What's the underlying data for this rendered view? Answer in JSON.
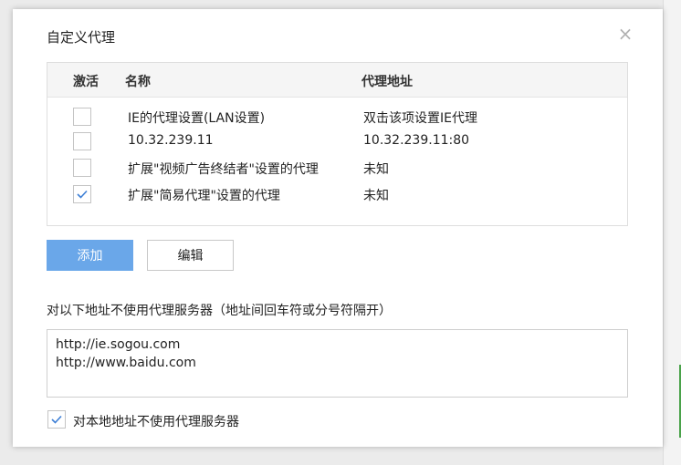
{
  "dialog": {
    "title": "自定义代理",
    "close_icon": "close-icon"
  },
  "table": {
    "headers": {
      "active": "激活",
      "name": "名称",
      "address": "代理地址"
    },
    "rows": [
      {
        "checked": false,
        "name": "IE的代理设置(LAN设置)",
        "address": "双击该项设置IE代理"
      },
      {
        "checked": false,
        "name": "10.32.239.11",
        "address": "10.32.239.11:80"
      },
      {
        "checked": false,
        "name": "扩展\"视频广告终结者\"设置的代理",
        "address": "未知"
      },
      {
        "checked": true,
        "name": "扩展\"简易代理\"设置的代理",
        "address": "未知"
      }
    ]
  },
  "buttons": {
    "add": "添加",
    "edit": "编辑"
  },
  "bypass": {
    "label": "对以下地址不使用代理服务器（地址间回车符或分号符隔开）",
    "lines": [
      "http://ie.sogou.com",
      "http://www.baidu.com"
    ]
  },
  "local": {
    "checked": true,
    "label": "对本地地址不使用代理服务器"
  },
  "colors": {
    "accent": "#6aa7e9",
    "check": "#3d7fd6"
  }
}
